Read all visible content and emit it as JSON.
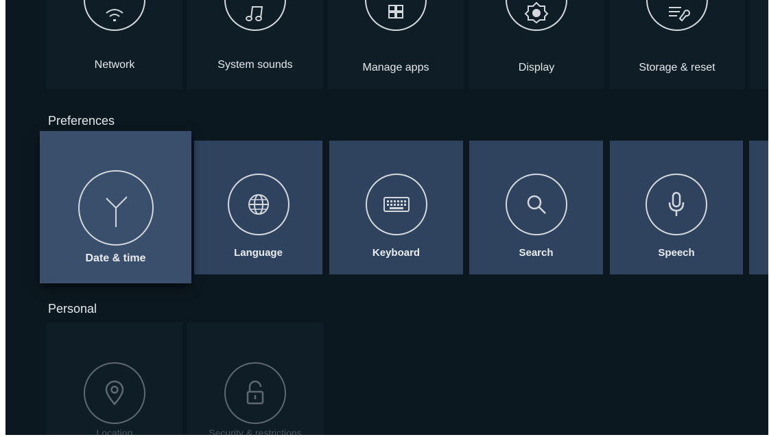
{
  "top_row": [
    {
      "label": "Network",
      "icon": "wifi-icon"
    },
    {
      "label": "System sounds",
      "icon": "music-note-icon"
    },
    {
      "label": "Manage apps",
      "icon": "grid-apps-icon"
    },
    {
      "label": "Display",
      "icon": "display-brightness-icon"
    },
    {
      "label": "Storage & reset",
      "icon": "storage-tools-icon"
    }
  ],
  "preferences": {
    "title": "Preferences",
    "items": [
      {
        "label": "Date & time",
        "icon": "clock-icon",
        "focused": true
      },
      {
        "label": "Language",
        "icon": "globe-icon"
      },
      {
        "label": "Keyboard",
        "icon": "keyboard-icon"
      },
      {
        "label": "Search",
        "icon": "search-icon"
      },
      {
        "label": "Speech",
        "icon": "microphone-icon"
      }
    ]
  },
  "personal": {
    "title": "Personal",
    "items": [
      {
        "label": "Location",
        "icon": "location-pin-icon"
      },
      {
        "label": "Security & restrictions",
        "icon": "unlock-icon"
      }
    ]
  },
  "colors": {
    "background": "#0c1820",
    "tile_dark": "#0f1d27",
    "tile_preferences": "#2f435e",
    "tile_focused": "#3a4f6c",
    "icon_stroke": "#d3d8dd"
  }
}
